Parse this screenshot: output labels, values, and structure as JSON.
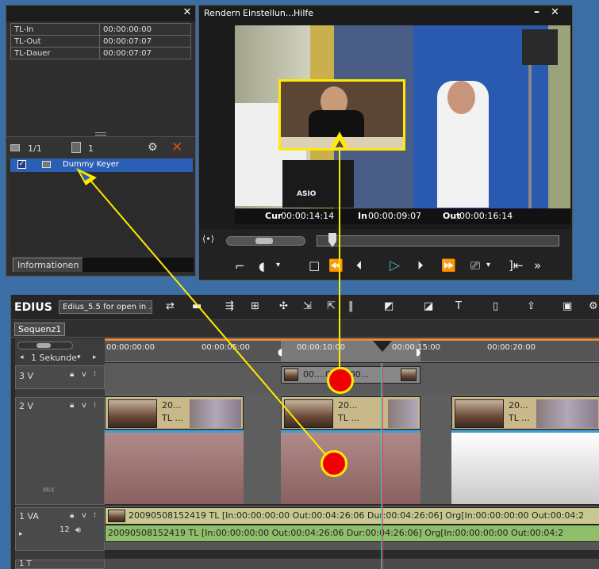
{
  "info_panel": {
    "rows": [
      {
        "label": "TL-In",
        "value": "00:00:00:00"
      },
      {
        "label": "TL-Out",
        "value": "00:00:07:07"
      },
      {
        "label": "TL-Dauer",
        "value": "00:00:07:07"
      }
    ],
    "count_display": "1/1",
    "layer_count": "1",
    "filter_item": "Dummy Keyer",
    "tab_label": "Informationen"
  },
  "player": {
    "menu": [
      "Rendern",
      "Einstellun...",
      "Hilfe"
    ],
    "cur_label": "Cur",
    "cur_value": "00:00:14:14",
    "in_label": "In",
    "in_value": "00:00:09:07",
    "out_label": "Out",
    "out_value": "00:00:16:14",
    "video_overlay_text": "ASIO"
  },
  "edius": {
    "app_name": "EDIUS",
    "project_name": "Edius_5.5 for open in ...",
    "sequence_tab": "Sequenz1",
    "zoom_label": "1 Sekunde",
    "ruler_ticks": [
      "00:00:00:00",
      "00:00:05:00",
      "00:00:10:00",
      "00:00:15:00",
      "00:00:20:00"
    ],
    "tracks": {
      "v3": "3 V",
      "v2": "2 V",
      "va1": "1 VA",
      "audio_ch": "12",
      "t1": "1 T"
    },
    "v3_clip_text": "00....07 F100...",
    "v2_clip_text_a": "20...",
    "v2_clip_text_b": "TL ...",
    "va1_video_text": "20090508152419  TL [In:00:00:00:00 Out:00:04:26:06 Dur:00:04:26:06]  Org[In:00:00:00:00 Out:00:04:2",
    "va1_audio_text": "20090508152419  TL [In:00:00:00:00 Out:00:04:26:06 Dur:00:04:26:06]  Org[In:00:00:00:00 Out:00:04:2",
    "mix_label": "MIX"
  },
  "colors": {
    "highlight": "#ffea00",
    "marker": "#e00000",
    "selection": "#2b5fb5"
  }
}
